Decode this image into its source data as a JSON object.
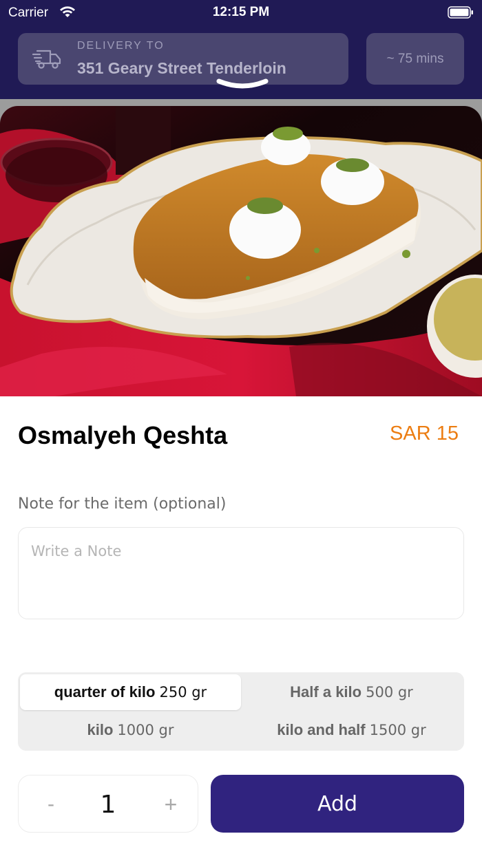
{
  "status_bar": {
    "carrier": "Carrier",
    "time": "12:15 PM"
  },
  "delivery": {
    "label": "DELIVERY TO",
    "address": "351 Geary Street Tenderloin",
    "eta": "~ 75 mins",
    "icon": "truck-icon"
  },
  "item": {
    "name": "Osmalyeh Qeshta",
    "price": "SAR 15",
    "image_alt": "Osmalyeh Qeshta"
  },
  "note": {
    "label": "Note for the item (optional)",
    "placeholder": "Write a Note",
    "value": ""
  },
  "sizes": [
    {
      "name": "quarter of kilo",
      "weight": "250 gr",
      "selected": true
    },
    {
      "name": "Half a kilo",
      "weight": "500 gr",
      "selected": false
    },
    {
      "name": "kilo",
      "weight": "1000 gr",
      "selected": false
    },
    {
      "name": "kilo and half",
      "weight": "1500 gr",
      "selected": false
    }
  ],
  "quantity": {
    "minus": "-",
    "value": "1",
    "plus": "+"
  },
  "add_button_label": "Add",
  "colors": {
    "header_bg": "#201a55",
    "accent": "#30237f",
    "price": "#ec7d12"
  }
}
